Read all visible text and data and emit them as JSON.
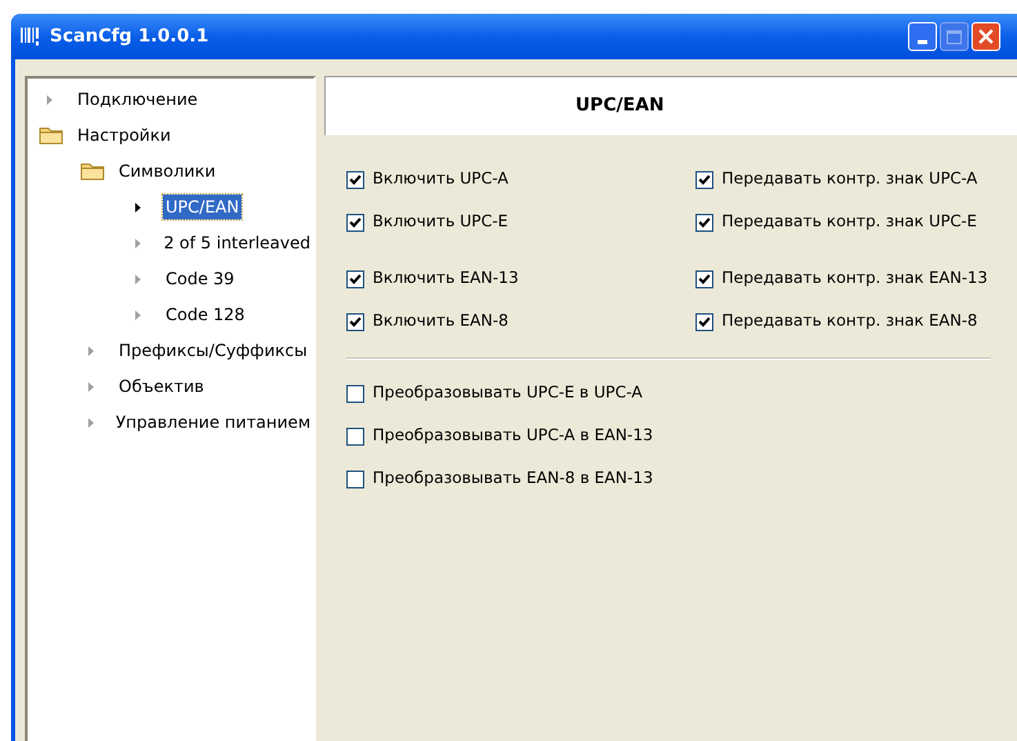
{
  "window": {
    "title": "ScanCfg 1.0.0.1"
  },
  "tree": [
    {
      "label": "Подключение",
      "kind": "leaf",
      "selected": false
    },
    {
      "label": "Настройки",
      "kind": "folder",
      "selected": false,
      "children": [
        {
          "label": "Символики",
          "kind": "folder",
          "selected": false,
          "children": [
            {
              "label": "UPC/EAN",
              "kind": "leaf",
              "selected": true
            },
            {
              "label": "2 of 5 interleaved",
              "kind": "leaf",
              "selected": false
            },
            {
              "label": "Code 39",
              "kind": "leaf",
              "selected": false
            },
            {
              "label": "Code 128",
              "kind": "leaf",
              "selected": false
            }
          ]
        },
        {
          "label": "Префиксы/Суффиксы",
          "kind": "leaf",
          "selected": false
        },
        {
          "label": "Объектив",
          "kind": "leaf",
          "selected": false
        },
        {
          "label": "Управление питанием",
          "kind": "leaf",
          "selected": false
        }
      ]
    }
  ],
  "panel": {
    "title": "UPC/EAN",
    "groups": [
      {
        "rows": [
          [
            {
              "label": "Включить UPC-A",
              "checked": true
            },
            {
              "label": "Передавать контр. знак UPC-A",
              "checked": true
            }
          ],
          [
            {
              "label": "Включить UPC-E",
              "checked": true
            },
            {
              "label": "Передавать контр. знак UPC-E",
              "checked": true
            }
          ]
        ]
      },
      {
        "rows": [
          [
            {
              "label": "Включить EAN-13",
              "checked": true
            },
            {
              "label": "Передавать контр. знак EAN-13",
              "checked": true
            }
          ],
          [
            {
              "label": "Включить EAN-8",
              "checked": true
            },
            {
              "label": "Передавать контр. знак EAN-8",
              "checked": true
            }
          ]
        ]
      }
    ],
    "conversions": [
      {
        "label": "Преобразовывать UPC-E в UPC-A",
        "checked": false
      },
      {
        "label": "Преобразовывать UPC-A в EAN-13",
        "checked": false
      },
      {
        "label": "Преобразовывать EAN-8 в EAN-13",
        "checked": false
      }
    ]
  }
}
